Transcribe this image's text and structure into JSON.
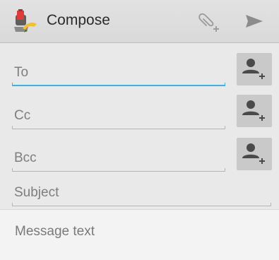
{
  "action_bar": {
    "title": "Compose",
    "app_icon": "email-app-icon",
    "attach_icon": "paperclip-add-icon",
    "send_icon": "send-icon"
  },
  "form": {
    "to_placeholder": "To",
    "cc_placeholder": "Cc",
    "bcc_placeholder": "Bcc",
    "subject_placeholder": "Subject",
    "add_contact_icon": "person-add-icon"
  },
  "message": {
    "placeholder": "Message text"
  },
  "colors": {
    "focus_accent": "#33b5e5",
    "action_bar_bg": "#dcdcdc",
    "button_bg": "#c9c9c9"
  }
}
